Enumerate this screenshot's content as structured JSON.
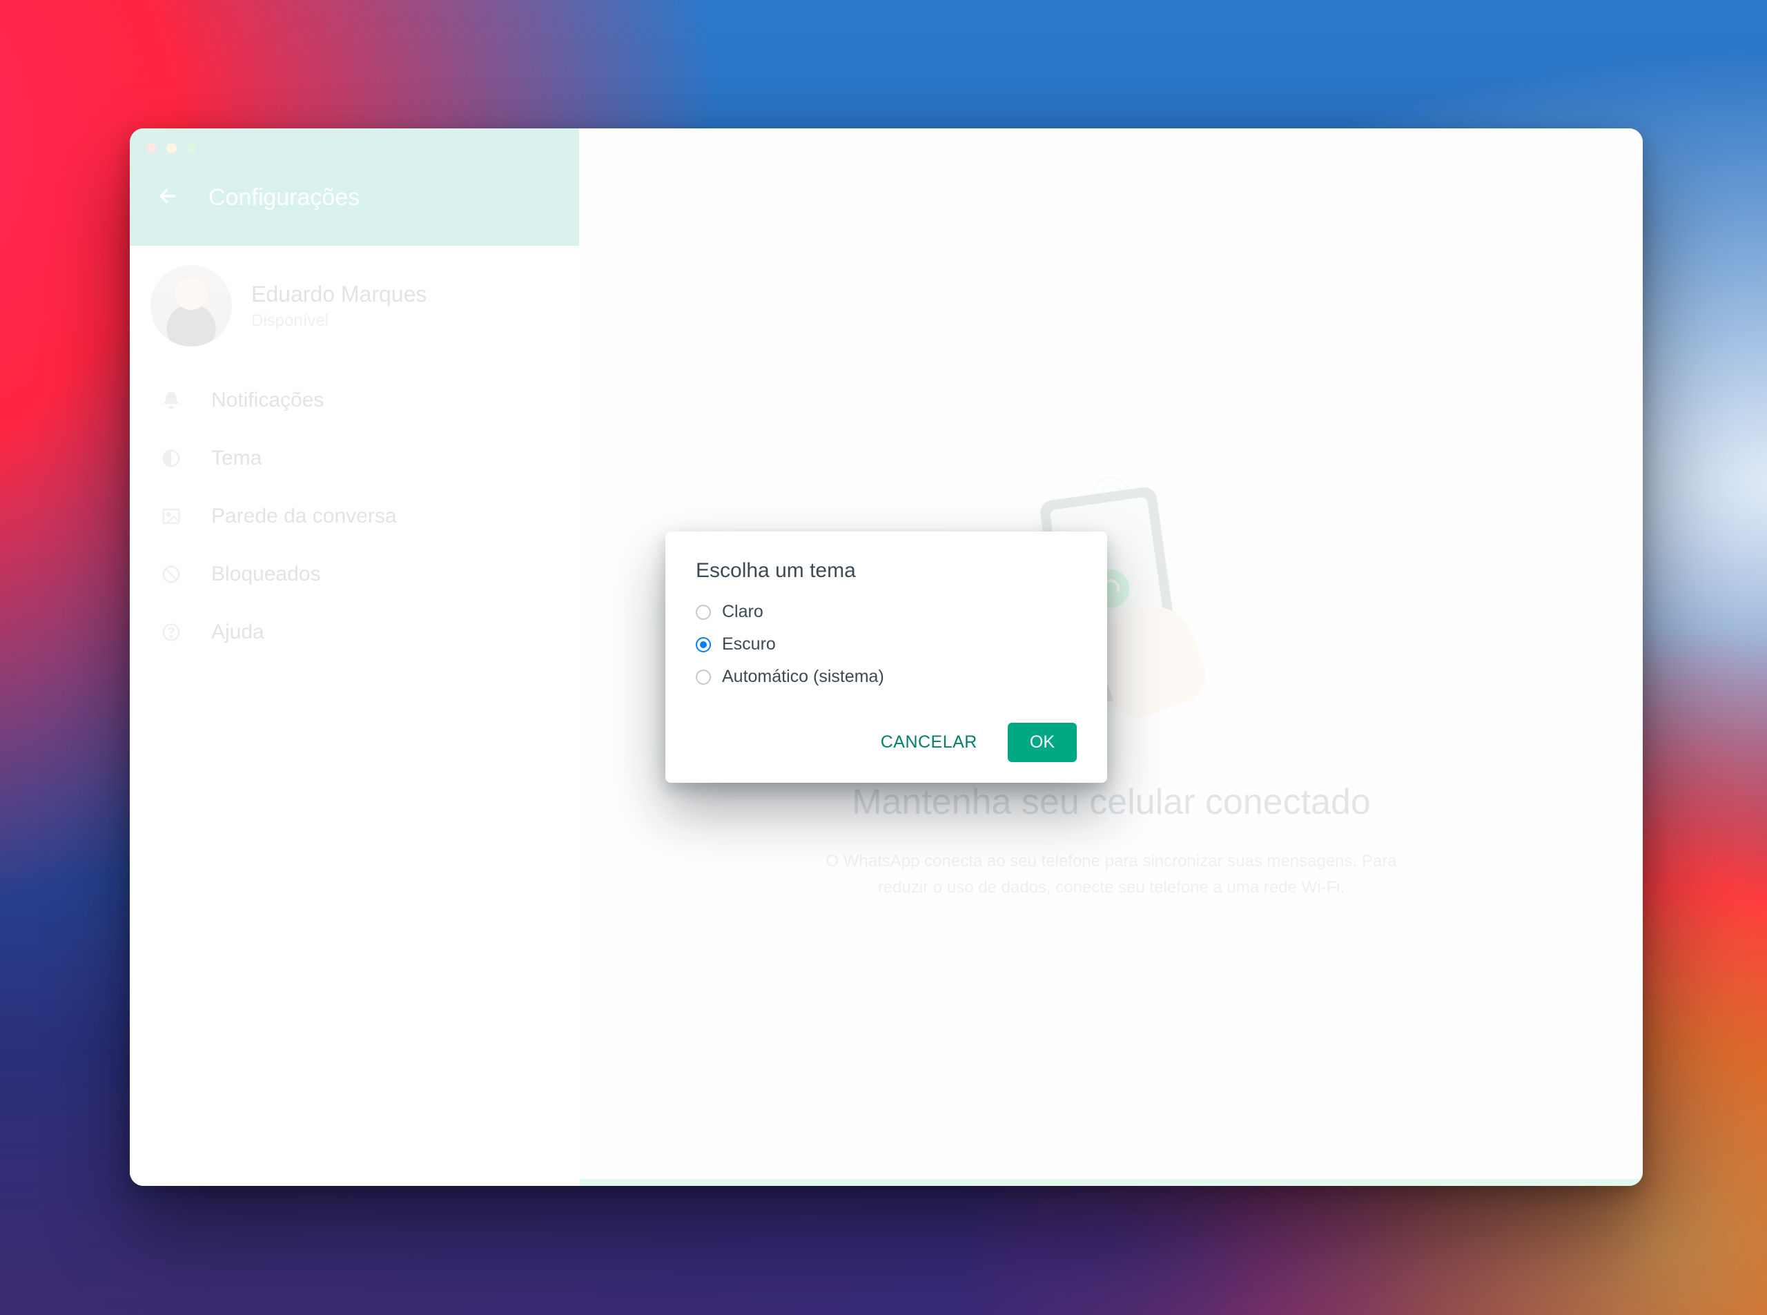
{
  "colors": {
    "accent": "#00a884",
    "accent_text": "#008069",
    "radio_selected": "#0a7cff"
  },
  "sidebar": {
    "header_title": "Configurações",
    "profile": {
      "name": "Eduardo Marques",
      "status": "Disponível"
    },
    "menu": [
      {
        "icon": "bell-icon",
        "label": "Notificações"
      },
      {
        "icon": "theme-icon",
        "label": "Tema"
      },
      {
        "icon": "image-icon",
        "label": "Parede da conversa"
      },
      {
        "icon": "block-icon",
        "label": "Bloqueados"
      },
      {
        "icon": "help-icon",
        "label": "Ajuda"
      }
    ]
  },
  "main": {
    "title": "Mantenha seu celular conectado",
    "subtitle": "O WhatsApp conecta ao seu telefone para sincronizar suas mensagens. Para reduzir o uso de dados, conecte seu telefone a uma rede Wi-Fi."
  },
  "modal": {
    "title": "Escolha um tema",
    "options": [
      {
        "label": "Claro",
        "selected": false
      },
      {
        "label": "Escuro",
        "selected": true
      },
      {
        "label": "Automático (sistema)",
        "selected": false
      }
    ],
    "cancel_label": "CANCELAR",
    "ok_label": "OK"
  }
}
